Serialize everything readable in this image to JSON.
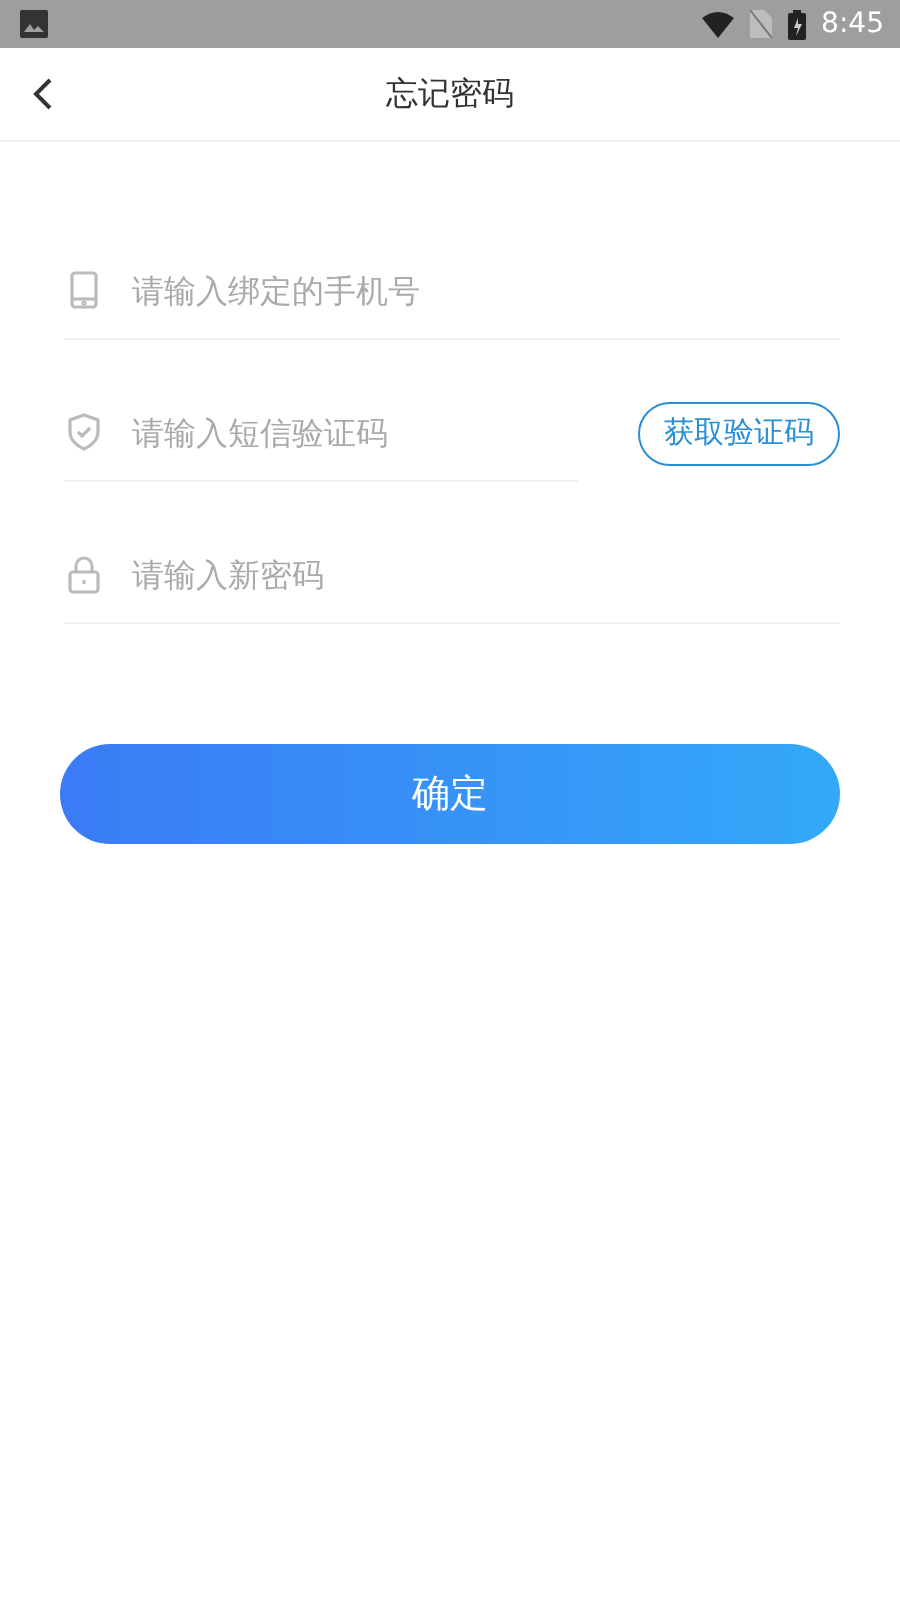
{
  "status_bar": {
    "time": "8:45"
  },
  "header": {
    "title": "忘记密码"
  },
  "fields": [
    {
      "kind": "phone",
      "placeholder": "请输入绑定的手机号"
    },
    {
      "kind": "shield",
      "placeholder": "请输入短信验证码",
      "action": "获取验证码"
    },
    {
      "kind": "lock",
      "placeholder": "请输入新密码"
    }
  ],
  "submit": "确定"
}
